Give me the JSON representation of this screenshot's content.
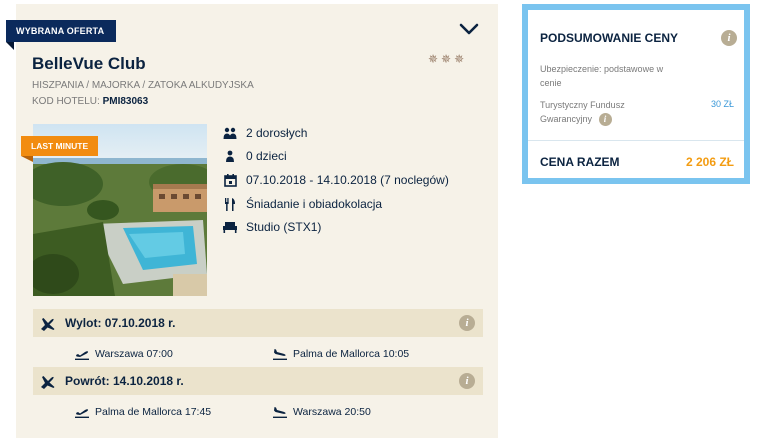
{
  "offer": {
    "ribbon_label": "WYBRANA OFERTA",
    "hotel_name": "BelleVue Club",
    "stars": "✵✵✵",
    "location": "HISZPANIA / MAJORKA / ZATOKA ALKUDYJSKA",
    "code_label": "KOD HOTELU:",
    "code_value": "PMI83063",
    "badge": "LAST MINUTE",
    "details": {
      "adults": "2 dorosłych",
      "children": "0 dzieci",
      "dates": "07.10.2018 - 14.10.2018 (7 noclegów)",
      "board": "Śniadanie i obiadokolacja",
      "room": "Studio (STX1)"
    },
    "icons": {
      "adults": "adults-icon",
      "children": "child-icon",
      "dates": "calendar-icon",
      "board": "cutlery-icon",
      "room": "bed-icon"
    }
  },
  "flights": {
    "outbound": {
      "title": "Wylot: 07.10.2018 r.",
      "departure": "Warszawa 07:00",
      "arrival": "Palma de Mallorca 10:05"
    },
    "return": {
      "title": "Powrót: 14.10.2018 r.",
      "departure": "Palma de Mallorca 17:45",
      "arrival": "Warszawa 20:50"
    }
  },
  "summary": {
    "title": "PODSUMOWANIE CENY",
    "insurance_line1": "Ubezpieczenie: podstawowe w",
    "insurance_line2": "cenie",
    "fund_line1": "Turystyczny Fundusz",
    "fund_line2": "Gwarancyjny",
    "fund_value": "30 ZŁ",
    "total_label": "CENA RAZEM",
    "total_value": "2 206 ZŁ"
  },
  "colors": {
    "navy": "#0b2a5c",
    "orange_badge": "#f28c10",
    "price_orange": "#f39c12",
    "summary_border": "#7ac4ef",
    "card_bg": "#f6f2e8",
    "flight_bar_bg": "#ebe3cc"
  }
}
